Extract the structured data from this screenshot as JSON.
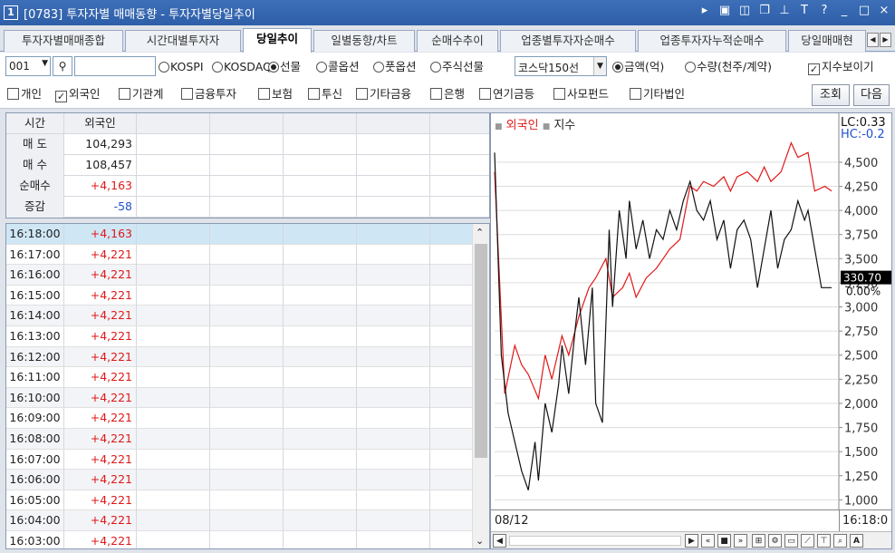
{
  "window": {
    "number": "1",
    "title": "[0783] 투자자별 매매동향 - 투자자별당일추이"
  },
  "tabs": [
    {
      "label": "투자자별매매종합"
    },
    {
      "label": "시간대별투자자"
    },
    {
      "label": "당일추이"
    },
    {
      "label": "일별동향/차트"
    },
    {
      "label": "순매수추이"
    },
    {
      "label": "업종별투자자순매수"
    },
    {
      "label": "업종투자자누적순매수"
    },
    {
      "label": "당일매매현"
    }
  ],
  "toolbar": {
    "code": "001",
    "search_value": "",
    "markets": [
      "KOSPI",
      "KOSDAQ",
      "선물",
      "콜옵션",
      "풋옵션",
      "주식선물"
    ],
    "market_selected": "선물",
    "index_select": "코스닥150선",
    "units": [
      "금액(억)",
      "수량(천주/계약)"
    ],
    "unit_selected": "금액(억)",
    "show_index_label": "지수보이기",
    "show_index_checked": true
  },
  "investors": [
    {
      "label": "개인",
      "checked": false
    },
    {
      "label": "외국인",
      "checked": true
    },
    {
      "label": "기관계",
      "checked": false
    },
    {
      "label": "금융투자",
      "checked": false
    },
    {
      "label": "보험",
      "checked": false
    },
    {
      "label": "투신",
      "checked": false
    },
    {
      "label": "기타금융",
      "checked": false
    },
    {
      "label": "은행",
      "checked": false
    },
    {
      "label": "연기금등",
      "checked": false
    },
    {
      "label": "사모펀드",
      "checked": false
    },
    {
      "label": "기타법인",
      "checked": false
    }
  ],
  "buttons": {
    "query": "조회",
    "next": "다음"
  },
  "summary": {
    "headers": [
      "시간",
      "외국인"
    ],
    "rows": [
      {
        "label": "매 도",
        "value": "104,293",
        "color": "#222222"
      },
      {
        "label": "매 수",
        "value": "108,457",
        "color": "#222222"
      },
      {
        "label": "순매수",
        "value": "+4,163",
        "color": "#e01818"
      },
      {
        "label": "증감",
        "value": "-58",
        "color": "#1e50d0"
      }
    ]
  },
  "grid_rows": [
    {
      "time": "16:18:00",
      "value": "+4,163"
    },
    {
      "time": "16:17:00",
      "value": "+4,221"
    },
    {
      "time": "16:16:00",
      "value": "+4,221"
    },
    {
      "time": "16:15:00",
      "value": "+4,221"
    },
    {
      "time": "16:14:00",
      "value": "+4,221"
    },
    {
      "time": "16:13:00",
      "value": "+4,221"
    },
    {
      "time": "16:12:00",
      "value": "+4,221"
    },
    {
      "time": "16:11:00",
      "value": "+4,221"
    },
    {
      "time": "16:10:00",
      "value": "+4,221"
    },
    {
      "time": "16:09:00",
      "value": "+4,221"
    },
    {
      "time": "16:08:00",
      "value": "+4,221"
    },
    {
      "time": "16:07:00",
      "value": "+4,221"
    },
    {
      "time": "16:06:00",
      "value": "+4,221"
    },
    {
      "time": "16:05:00",
      "value": "+4,221"
    },
    {
      "time": "16:04:00",
      "value": "+4,221"
    },
    {
      "time": "16:03:00",
      "value": "+4,221"
    }
  ],
  "colors": {
    "foreign": "#e01818",
    "index": "#111111",
    "selected_row": "#cfe6f5",
    "accent": "#2e5ea8"
  },
  "chart_data": {
    "type": "line",
    "legend": [
      "외국인",
      "지수"
    ],
    "legend_placement": "top-left",
    "y_ticks": [
      "4,500",
      "4,250",
      "4,000",
      "3,750",
      "3,500",
      "3,250",
      "3,000",
      "2,750",
      "2,500",
      "2,250",
      "2,000",
      "1,750",
      "1,500",
      "1,250",
      "1,000"
    ],
    "ylim": [
      900,
      4800
    ],
    "y_tick_values": [
      4500,
      4250,
      4000,
      3750,
      3500,
      3250,
      3000,
      2750,
      2500,
      2250,
      2000,
      1750,
      1500,
      1250,
      1000
    ],
    "grid": true,
    "top_labels": [
      "LC:0.33",
      "HC:-0.2"
    ],
    "current_label": "330.70",
    "current_pct": "0.00%",
    "x_start_label": "08/12",
    "x_end_label": "16:18:0",
    "xlim": [
      0,
      100
    ],
    "series": [
      {
        "name": "외국인",
        "color": "#e01818",
        "x": [
          0,
          3,
          6,
          8,
          10,
          13,
          15,
          17,
          20,
          22,
          25,
          28,
          30,
          33,
          35,
          38,
          40,
          42,
          45,
          48,
          50,
          52,
          55,
          58,
          60,
          62,
          65,
          68,
          70,
          72,
          75,
          78,
          80,
          82,
          85,
          88,
          90,
          93,
          95,
          98,
          100
        ],
        "y": [
          4400,
          2100,
          2600,
          2400,
          2300,
          2050,
          2500,
          2250,
          2700,
          2500,
          2900,
          3200,
          3300,
          3500,
          3100,
          3200,
          3350,
          3100,
          3300,
          3400,
          3500,
          3600,
          3700,
          4250,
          4200,
          4300,
          4250,
          4350,
          4200,
          4350,
          4400,
          4300,
          4450,
          4300,
          4400,
          4700,
          4550,
          4600,
          4200,
          4250,
          4200
        ]
      },
      {
        "name": "지수",
        "color": "#111111",
        "x": [
          0,
          2,
          4,
          6,
          8,
          10,
          12,
          13,
          15,
          17,
          19,
          20,
          22,
          24,
          25,
          27,
          29,
          30,
          32,
          34,
          35,
          37,
          39,
          40,
          42,
          44,
          46,
          48,
          50,
          52,
          54,
          56,
          58,
          60,
          62,
          64,
          66,
          68,
          70,
          72,
          74,
          76,
          78,
          80,
          82,
          84,
          86,
          88,
          90,
          92,
          93,
          95,
          97,
          100
        ],
        "y": [
          4600,
          2500,
          1900,
          1600,
          1300,
          1100,
          1600,
          1200,
          2000,
          1700,
          2200,
          2600,
          2100,
          2800,
          3100,
          2400,
          3200,
          2000,
          1800,
          3800,
          3000,
          4000,
          3500,
          4100,
          3600,
          3900,
          3500,
          3800,
          3700,
          4000,
          3800,
          4100,
          4300,
          4000,
          3900,
          4100,
          3700,
          3900,
          3400,
          3800,
          3900,
          3700,
          3200,
          3600,
          4000,
          3400,
          3700,
          3800,
          4100,
          3900,
          4000,
          3600,
          3200,
          3200
        ]
      }
    ]
  }
}
